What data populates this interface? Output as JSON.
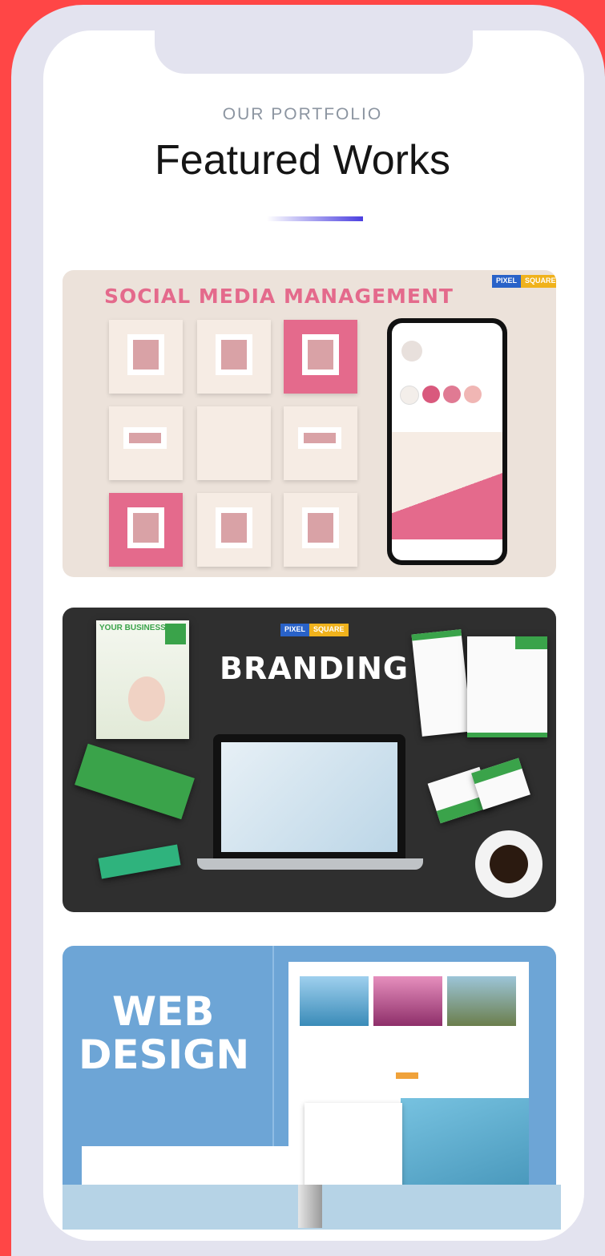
{
  "section": {
    "eyebrow": "OUR PORTFOLIO",
    "title": "Featured Works"
  },
  "cards": [
    {
      "title": "SOCIAL MEDIA MANAGEMENT",
      "badge_left": "PIXEL",
      "badge_right": "SQUARE"
    },
    {
      "title": "BRANDING",
      "badge_left": "PIXEL",
      "badge_right": "SQUARE",
      "book_title": "YOUR BUSINESS"
    },
    {
      "title_line1": "WEB",
      "title_line2": "DESIGN"
    }
  ],
  "colors": {
    "background": "#ff4646",
    "accent": "#4b3fe0",
    "social_pink": "#e46a8c",
    "branding_green": "#3aa34a",
    "web_blue": "#6da5d6"
  }
}
